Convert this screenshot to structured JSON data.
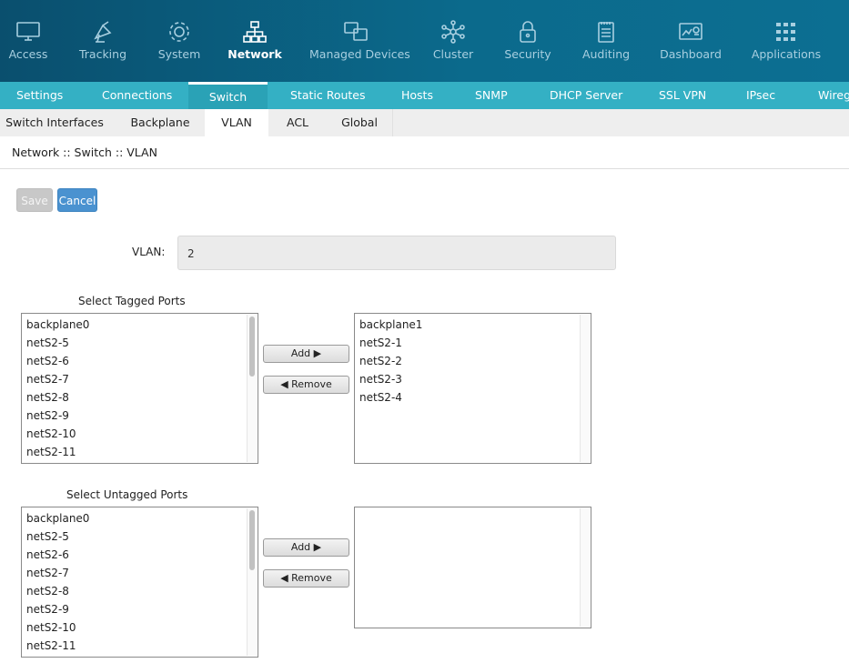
{
  "topnav": [
    {
      "label": "Access",
      "icon": "monitor-icon"
    },
    {
      "label": "Tracking",
      "icon": "satellite-icon"
    },
    {
      "label": "System",
      "icon": "gear-icon"
    },
    {
      "label": "Network",
      "icon": "network-icon"
    },
    {
      "label": "Managed Devices",
      "icon": "devices-icon"
    },
    {
      "label": "Cluster",
      "icon": "cluster-icon"
    },
    {
      "label": "Security",
      "icon": "lock-icon"
    },
    {
      "label": "Auditing",
      "icon": "notepad-icon"
    },
    {
      "label": "Dashboard",
      "icon": "dashboard-icon"
    },
    {
      "label": "Applications",
      "icon": "grid-icon"
    }
  ],
  "subnav": [
    "Settings",
    "Connections",
    "Switch",
    "Static Routes",
    "Hosts",
    "SNMP",
    "DHCP Server",
    "SSL VPN",
    "IPsec",
    "Wireg"
  ],
  "thirdnav": [
    "Switch Interfaces",
    "Backplane",
    "VLAN",
    "ACL",
    "Global"
  ],
  "breadcrumb": "Network :: Switch :: VLAN",
  "buttons": {
    "save": "Save",
    "cancel": "Cancel"
  },
  "vlan": {
    "label": "VLAN:",
    "value": "2"
  },
  "tagged": {
    "title": "Select Tagged Ports",
    "available": [
      "backplane0",
      "netS2-5",
      "netS2-6",
      "netS2-7",
      "netS2-8",
      "netS2-9",
      "netS2-10",
      "netS2-11"
    ],
    "selected": [
      "backplane1",
      "netS2-1",
      "netS2-2",
      "netS2-3",
      "netS2-4"
    ],
    "add": "Add ▶",
    "remove": "◀ Remove"
  },
  "untagged": {
    "title": "Select Untagged Ports",
    "available": [
      "backplane0",
      "netS2-5",
      "netS2-6",
      "netS2-7",
      "netS2-8",
      "netS2-9",
      "netS2-10",
      "netS2-11"
    ],
    "selected": [],
    "add": "Add ▶",
    "remove": "◀ Remove"
  },
  "colors": {
    "topnav": "#0b6a8c",
    "subnav": "#34b0c4",
    "cancel": "#4a92d0"
  }
}
